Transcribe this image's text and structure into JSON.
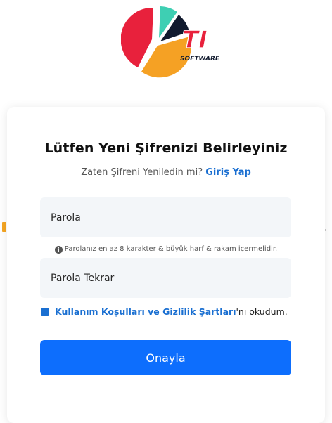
{
  "logo": {
    "initials": "TI",
    "subtitle": "SOFTWARE",
    "colors": {
      "red": "#e8213c",
      "teal": "#3ecfb3",
      "navy": "#111a2e",
      "orange": "#f5a124"
    }
  },
  "form": {
    "title": "Lütfen Yeni Şifrenizi Belirleyiniz",
    "subtitle_text": "Zaten Şifreni Yeniledin mi?",
    "login_link": "Giriş Yap",
    "password_placeholder": "Parola",
    "hint_icon": "info-icon",
    "hint_text": "Parolanız en az 8 karakter & büyük harf & rakam içermelidir.",
    "repeat_placeholder": "Parola Tekrar",
    "terms_link": "Kullanım Koşulları ve Gizlilik Şartları",
    "terms_suffix": "'nı okudum.",
    "submit_label": "Onayla"
  },
  "colors": {
    "accent": "#0d6efd",
    "link": "#1a6fd1",
    "field_bg": "#f3f6f9"
  }
}
